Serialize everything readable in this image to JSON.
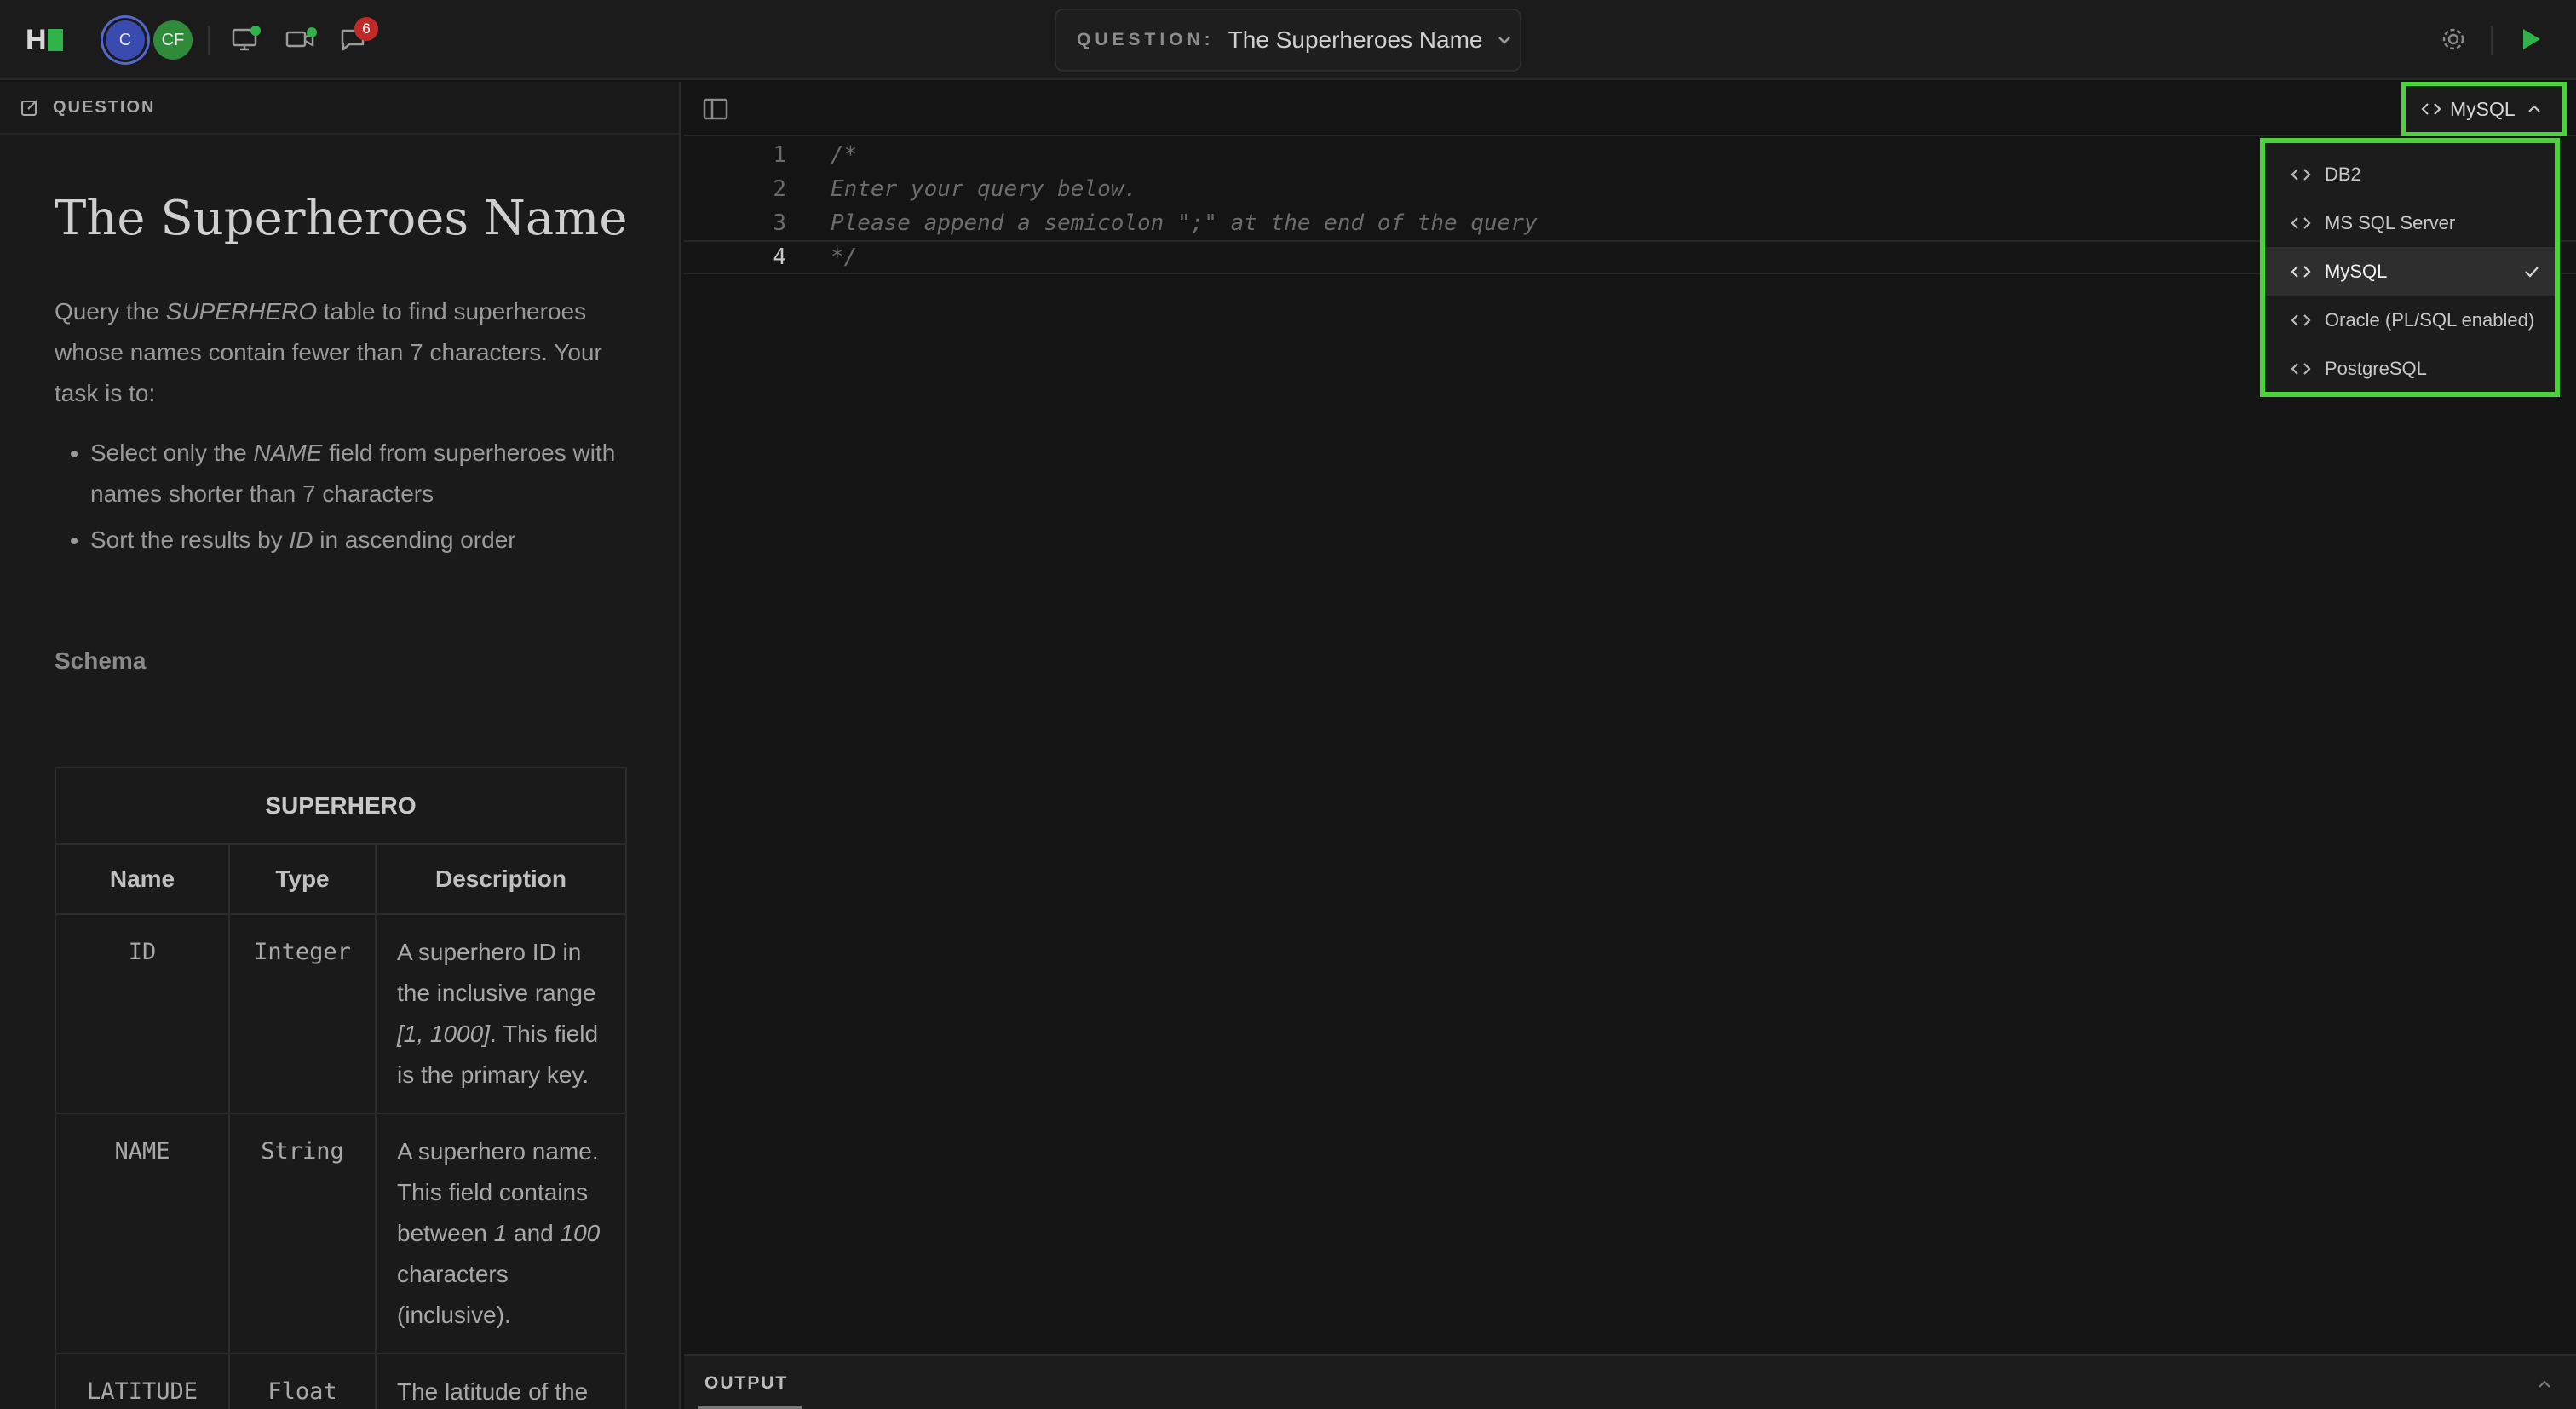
{
  "header": {
    "avatars": [
      {
        "initials": "C"
      },
      {
        "initials": "CF"
      }
    ],
    "notifications_count": "6",
    "question_label": "QUESTION:",
    "question_title": "The Superheroes Name"
  },
  "left_panel": {
    "section_label": "QUESTION",
    "title": "The Superheroes Name",
    "intro_a": "Query the ",
    "intro_table": "SUPERHERO",
    "intro_b": " table to find superheroes whose names contain fewer than 7 characters. Your task is to:",
    "bullet1_a": "Select only the ",
    "bullet1_field": "NAME",
    "bullet1_b": " field from superheroes with names shorter than 7 characters",
    "bullet2_a": "Sort the results by ",
    "bullet2_field": "ID",
    "bullet2_b": " in ascending order",
    "schema_heading": "Schema",
    "schema": {
      "table_name": "SUPERHERO",
      "headers": [
        "Name",
        "Type",
        "Description"
      ],
      "rows": [
        {
          "name": "ID",
          "type": "Integer",
          "desc_a": "A superhero ID in the inclusive range ",
          "desc_range": "[1, 1000]",
          "desc_b": ". This field is the primary key."
        },
        {
          "name": "NAME",
          "type": "String",
          "desc_a": "A superhero name. This field contains between ",
          "desc_min": "1",
          "desc_mid": " and ",
          "desc_max": "100",
          "desc_b": " characters (inclusive)."
        },
        {
          "name": "LATITUDE",
          "type": "Float",
          "desc": "The latitude of the"
        }
      ]
    }
  },
  "editor": {
    "language": "MySQL",
    "lines": [
      {
        "num": "1",
        "text": "/*"
      },
      {
        "num": "2",
        "text": "Enter your query below."
      },
      {
        "num": "3",
        "text": "Please append a semicolon \";\" at the end of the query"
      },
      {
        "num": "4",
        "text": "*/"
      }
    ],
    "language_options": [
      "DB2",
      "MS SQL Server",
      "MySQL",
      "Oracle (PL/SQL enabled)",
      "PostgreSQL"
    ],
    "selected_language": "MySQL"
  },
  "output": {
    "label": "OUTPUT"
  },
  "colors": {
    "accent": "#2fb34a",
    "highlight": "#4cd33c",
    "badge": "#c22a2a"
  }
}
